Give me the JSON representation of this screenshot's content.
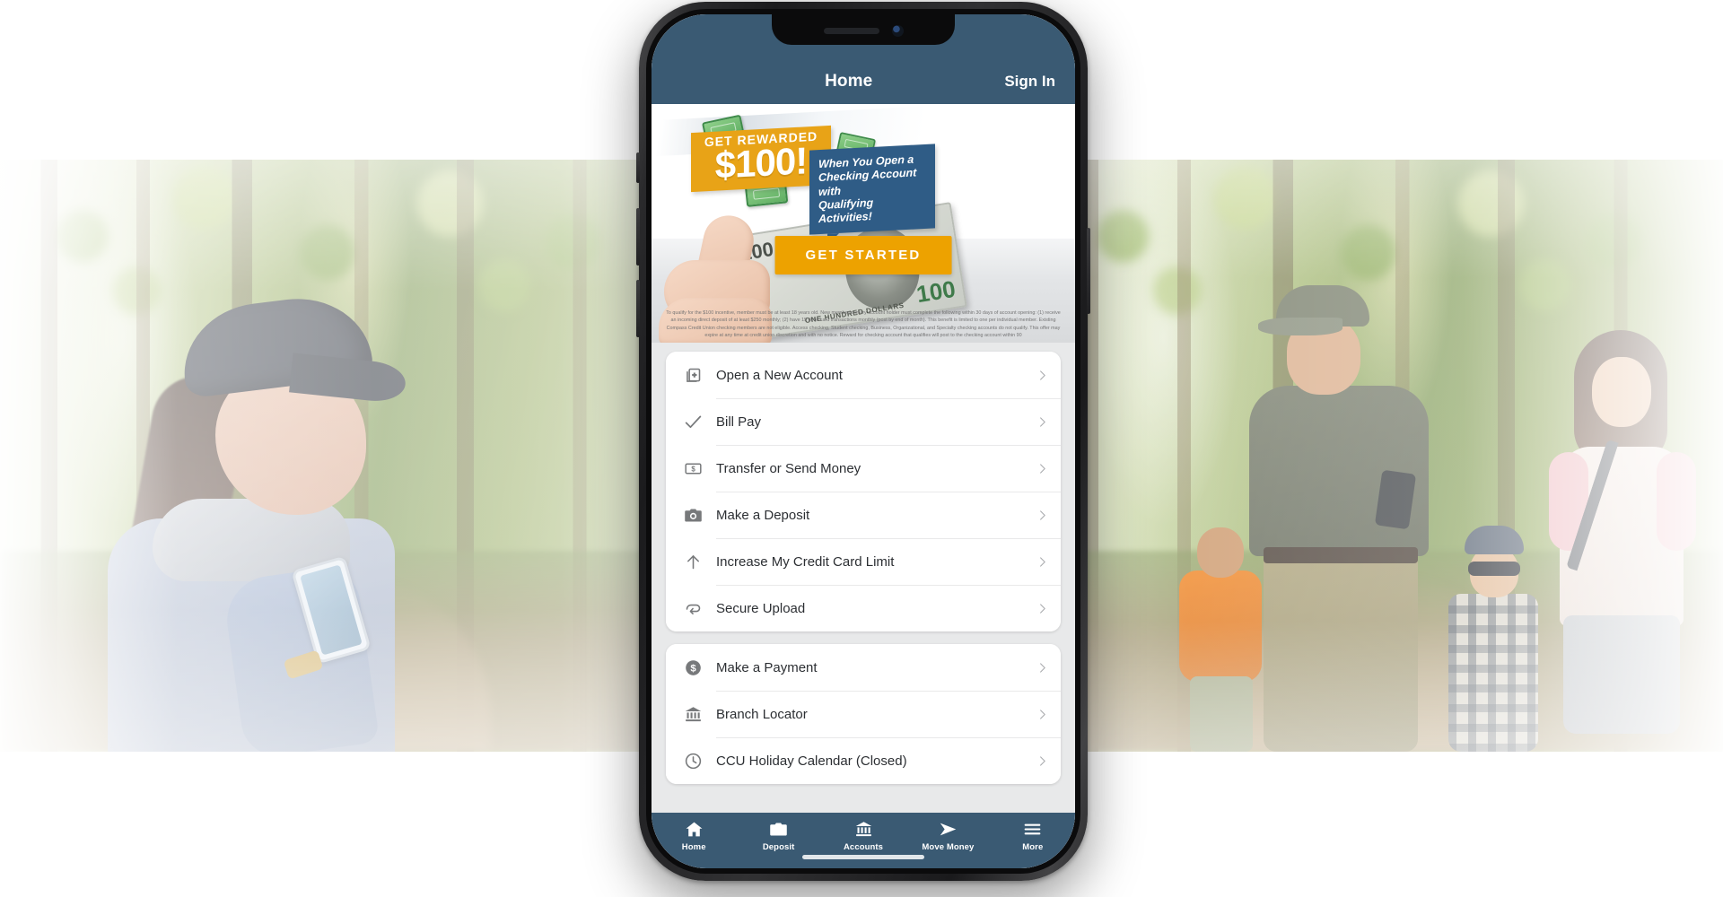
{
  "scene": {
    "background_photos": [
      {
        "name": "woman-hiking-with-phone",
        "description": "Woman in dark baseball cap holding smartphone on a forest trail"
      },
      {
        "name": "family-hiking-forest",
        "description": "Family of four walking on a forest trail, father looking at phone"
      }
    ]
  },
  "device": {
    "model": "iphone-x",
    "frame_color": "#2a2a2c"
  },
  "app": {
    "colors": {
      "header_blue": "#3a5a73",
      "accent_gold": "#eda200",
      "promo_gold": "#e8a317",
      "promo_blue": "#2f5c86",
      "page_bg": "#e8e9ea",
      "card_white": "#ffffff",
      "text_primary": "#2c2f33",
      "icon_grey": "#77797b",
      "chevron_grey": "#a9abae"
    },
    "header": {
      "title": "Home",
      "sign_in_label": "Sign In"
    },
    "promo": {
      "badge_line1": "GET REWARDED",
      "badge_line2": "$100!",
      "callout_line1": "When You Open a",
      "callout_line2": "Checking Account with",
      "callout_line3": "Qualifying Activities!",
      "cta_label": "GET STARTED",
      "bill_denomination_left": "100",
      "bill_denomination_right": "100",
      "bill_caption": "ONE HUNDRED DOLLARS",
      "fineprint": "To qualify for the $100 incentive, member must be at least 18 years old. New member/primary account holder must complete the following within 30 days of account opening: (1) receive an incoming direct deposit of at least $250 monthly; (2) have 15 debit card transactions monthly (post by end of month). This benefit is limited to one per individual member. Existing Compass Credit Union checking members are not eligible. Access checking, Student checking, Business, Organizational, and Specialty checking accounts do not qualify. This offer may expire at any time at credit union discretion and with no notice. Reward for checking account that qualifies will post to the checking account within 90"
    },
    "menu_groups": [
      {
        "name": "primary-actions",
        "items": [
          {
            "label": "Open a New Account",
            "icon": "add-document-icon"
          },
          {
            "label": "Bill Pay",
            "icon": "checkmark-icon"
          },
          {
            "label": "Transfer or Send Money",
            "icon": "money-card-icon"
          },
          {
            "label": "Make a Deposit",
            "icon": "camera-icon"
          },
          {
            "label": "Increase My Credit Card Limit",
            "icon": "arrow-up-icon"
          },
          {
            "label": "Secure Upload",
            "icon": "upload-loop-icon"
          }
        ]
      },
      {
        "name": "secondary-actions",
        "items": [
          {
            "label": "Make a Payment",
            "icon": "dollar-circle-icon"
          },
          {
            "label": "Branch Locator",
            "icon": "bank-icon"
          },
          {
            "label": "CCU Holiday Calendar (Closed)",
            "icon": "clock-icon"
          }
        ]
      }
    ],
    "tabbar": [
      {
        "label": "Home",
        "icon": "home-icon",
        "active": true
      },
      {
        "label": "Deposit",
        "icon": "camera-icon",
        "active": false
      },
      {
        "label": "Accounts",
        "icon": "bank-icon",
        "active": false
      },
      {
        "label": "Move Money",
        "icon": "send-arrow-icon",
        "active": false
      },
      {
        "label": "More",
        "icon": "hamburger-icon",
        "active": false
      }
    ]
  }
}
